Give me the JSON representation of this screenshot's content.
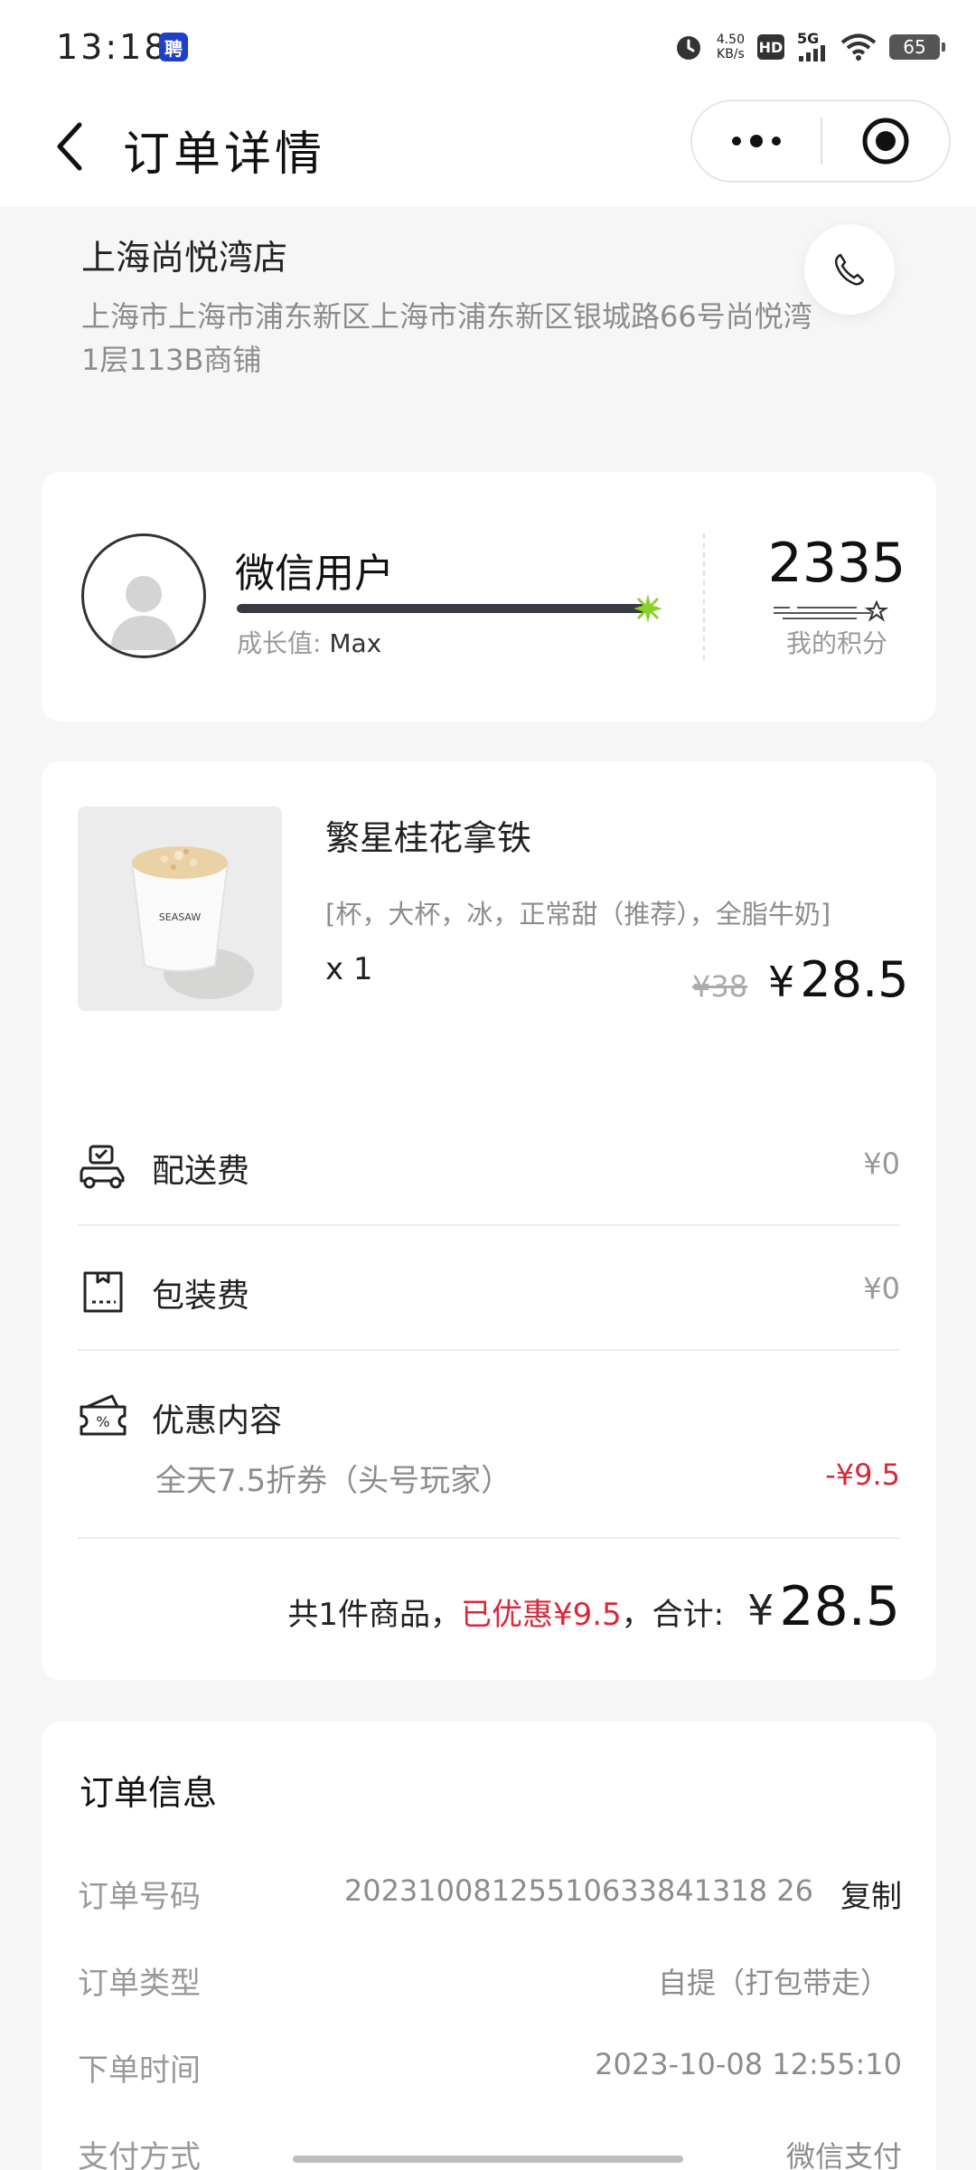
{
  "status_bar": {
    "time": "13:18",
    "app_badge": "聘",
    "net_speed_value": "4.50",
    "net_speed_unit": "KB/s",
    "hd_label": "HD",
    "signal_label": "5G",
    "battery": "65"
  },
  "nav": {
    "title": "订单详情"
  },
  "store": {
    "name": "上海尚悦湾店",
    "address": "上海市上海市浦东新区上海市浦东新区银城路66号尚悦湾1层113B商铺"
  },
  "member": {
    "user_name": "微信用户",
    "growth_label": "成长值:",
    "growth_value": "Max",
    "points": "2335",
    "points_label": "我的积分"
  },
  "product": {
    "name": "繁星桂花拿铁",
    "specs": "[杯，大杯，冰，正常甜（推荐），全脂牛奶]",
    "quantity": "x 1",
    "original_price": "¥38",
    "currency": "¥",
    "price": "28.5",
    "cup_brand": "SEASAW"
  },
  "fees": {
    "delivery_label": "配送费",
    "delivery_value": "¥0",
    "packaging_label": "包装费",
    "packaging_value": "¥0",
    "discount_label": "优惠内容",
    "discount_detail": "全天7.5折券（头号玩家）",
    "discount_value": "-¥9.5"
  },
  "summary": {
    "items_text": "共1件商品，",
    "saved_text": "已优惠¥9.5",
    "total_label": "，合计:",
    "currency": "¥",
    "total": "28.5"
  },
  "order_info": {
    "title": "订单信息",
    "order_no_label": "订单号码",
    "order_no": "20231008125510633841318 26",
    "copy_label": "复制",
    "type_label": "订单类型",
    "type": "自提（打包带走）",
    "time_label": "下单时间",
    "time": "2023-10-08 12:55:10",
    "pay_label": "支付方式",
    "pay": "微信支付"
  },
  "colors": {
    "accent_red": "#d8283a",
    "growth_bar": "#3a3a44",
    "growth_star": "#8bd12b"
  }
}
